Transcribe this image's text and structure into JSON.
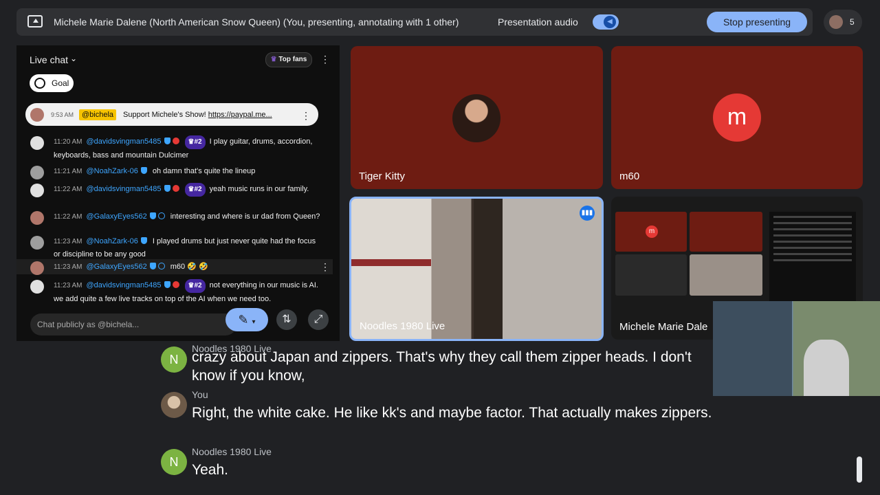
{
  "top_bar": {
    "presenting_title": "Michele Marie Dalene (North American Snow Queen) (You, presenting, annotating with 1 other)",
    "presentation_audio_label": "Presentation audio",
    "stop_presenting_label": "Stop presenting",
    "participant_count": "5"
  },
  "live_chat": {
    "title": "Live chat",
    "top_fans_label": "Top fans",
    "goal_label": "Goal",
    "pinned": {
      "time": "9:53 AM",
      "user": "@bichela",
      "text": "Support Michele's Show!",
      "link": "https://paypal.me..."
    },
    "messages": [
      {
        "time": "11:20 AM",
        "user": "@davidsvingman5485",
        "rank": "#2",
        "text": "I play guitar, drums, accordion, keyboards, bass and mountain Dulcimer"
      },
      {
        "time": "11:21 AM",
        "user": "@NoahZark-06",
        "text": "oh damn that's quite the lineup"
      },
      {
        "time": "11:22 AM",
        "user": "@davidsvingman5485",
        "rank": "#2",
        "text": "yeah music runs in our family."
      },
      {
        "time": "11:22 AM",
        "user": "@GalaxyEyes562",
        "text": "interesting and where is ur dad from Queen?"
      },
      {
        "time": "11:23 AM",
        "user": "@NoahZark-06",
        "text": "I played drums but just never quite had the focus or discipline to be any good"
      },
      {
        "time": "11:23 AM",
        "user": "@GalaxyEyes562",
        "text": "m60 🤣 🤣"
      },
      {
        "time": "11:23 AM",
        "user": "@davidsvingman5485",
        "rank": "#2",
        "text": "not everything in our music is AI. we add quite a few live tracks on top of the AI when we need too."
      }
    ],
    "input_placeholder": "Chat publicly as @bichela..."
  },
  "tiles": {
    "tiger_kitty": "Tiger Kitty",
    "m60": "m60",
    "m60_initial": "m",
    "noodles": "Noodles 1980 Live",
    "michele": "Michele Marie Dale"
  },
  "captions": [
    {
      "speaker": "Noodles 1980 Live",
      "initial": "N",
      "text": "crazy about Japan and zippers. That's why they call them zipper heads. I don't know if you know,"
    },
    {
      "speaker": "You",
      "text": "Right, the white cake. He like kk's and maybe factor. That actually makes zippers."
    },
    {
      "speaker": "Noodles 1980 Live",
      "initial": "N",
      "text": "Yeah."
    }
  ],
  "colors": {
    "accent": "#8ab4f8",
    "tile_bg": "#6e1c12",
    "avatar_red": "#e53935",
    "caption_green": "#7cb342",
    "chat_username": "#3ea6ff",
    "pinned_user_bg": "#f6c300"
  }
}
